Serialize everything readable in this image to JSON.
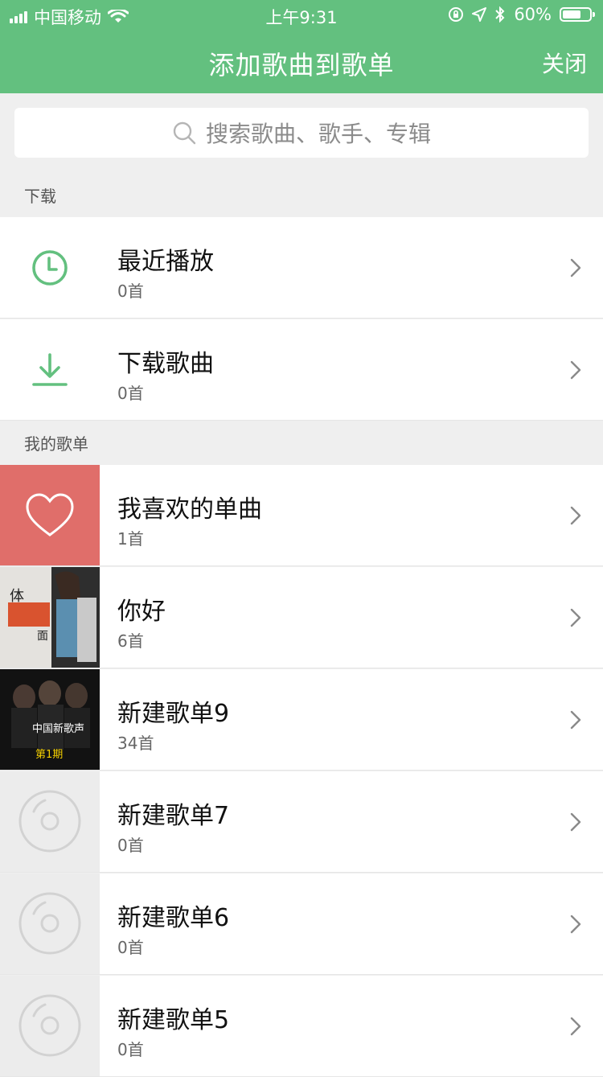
{
  "status": {
    "carrier": "中国移动",
    "time": "上午9:31",
    "battery": "60%"
  },
  "header": {
    "title": "添加歌曲到歌单",
    "close_label": "关闭"
  },
  "search": {
    "placeholder": "搜索歌曲、歌手、专辑"
  },
  "sections": {
    "download_label": "下载",
    "playlists_label": "我的歌单"
  },
  "download_items": [
    {
      "title": "最近播放",
      "count": "0首",
      "icon": "clock-icon"
    },
    {
      "title": "下载歌曲",
      "count": "0首",
      "icon": "download-icon"
    }
  ],
  "playlists": [
    {
      "title": "我喜欢的单曲",
      "count": "1首",
      "cover": "heart"
    },
    {
      "title": "你好",
      "count": "6首",
      "cover": "album-photo",
      "cover_text_1": "体",
      "cover_text_2": "面"
    },
    {
      "title": "新建歌单9",
      "count": "34首",
      "cover": "album-art",
      "cover_text_1": "中国新歌声",
      "cover_text_2": "第1期"
    },
    {
      "title": "新建歌单7",
      "count": "0首",
      "cover": "disc"
    },
    {
      "title": "新建歌单6",
      "count": "0首",
      "cover": "disc"
    },
    {
      "title": "新建歌单5",
      "count": "0首",
      "cover": "disc"
    }
  ],
  "colors": {
    "brand": "#63c07f",
    "heart_bg": "#e06e6a"
  }
}
